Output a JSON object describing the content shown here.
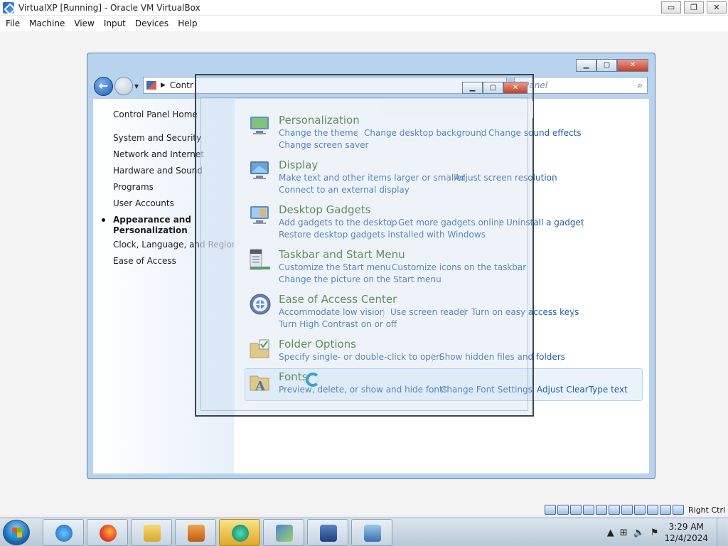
{
  "vbox": {
    "title": "VirtualXP [Running] - Oracle VM VirtualBox",
    "controls": [
      "▭",
      "❐",
      "✕"
    ],
    "menu": [
      "File",
      "Machine",
      "View",
      "Input",
      "Devices",
      "Help"
    ],
    "host_key": "Right Ctrl"
  },
  "control_panel": {
    "address_text": "Contr",
    "search_placeholder": "l Panel",
    "left_nav": {
      "home": "Control Panel Home",
      "items": [
        "System and Security",
        "Network and Internet",
        "Hardware and Sound",
        "Programs",
        "User Accounts"
      ],
      "current_line1": "Appearance and",
      "current_line2": "Personalization",
      "after": [
        "Clock, Language, and Region",
        "Ease of Access"
      ]
    },
    "categories": [
      {
        "title": "Personalization",
        "row1": [
          "Change the theme",
          "Change desktop background",
          "Change sound effects"
        ],
        "row2": [
          "Change screen saver"
        ]
      },
      {
        "title": "Display",
        "row1": [
          "Make text and other items larger or smaller",
          "Adjust screen resolution"
        ],
        "row2": [
          "Connect to an external display"
        ]
      },
      {
        "title": "Desktop Gadgets",
        "row1": [
          "Add gadgets to the desktop",
          "Get more gadgets online",
          "Uninstall a gadget"
        ],
        "row2": [
          "Restore desktop gadgets installed with Windows"
        ]
      },
      {
        "title": "Taskbar and Start Menu",
        "row1": [
          "Customize the Start menu",
          "Customize icons on the taskbar"
        ],
        "row2": [
          "Change the picture on the Start menu"
        ]
      },
      {
        "title": "Ease of Access Center",
        "row1": [
          "Accommodate low vision",
          "Use screen reader",
          "Turn on easy access keys"
        ],
        "row2": [
          "Turn High Contrast on or off"
        ]
      },
      {
        "title": "Folder Options",
        "row1": [
          "Specify single- or double-click to open",
          "Show hidden files and folders"
        ],
        "row2": []
      },
      {
        "title": "Fonts",
        "row1": [
          "Preview, delete, or show and hide fonts",
          "Change Font Settings",
          "Adjust ClearType text"
        ],
        "row2": []
      }
    ]
  },
  "taskbar": {
    "time": "3:29 AM",
    "date": "12/4/2024",
    "tray_arrow": "▲"
  }
}
